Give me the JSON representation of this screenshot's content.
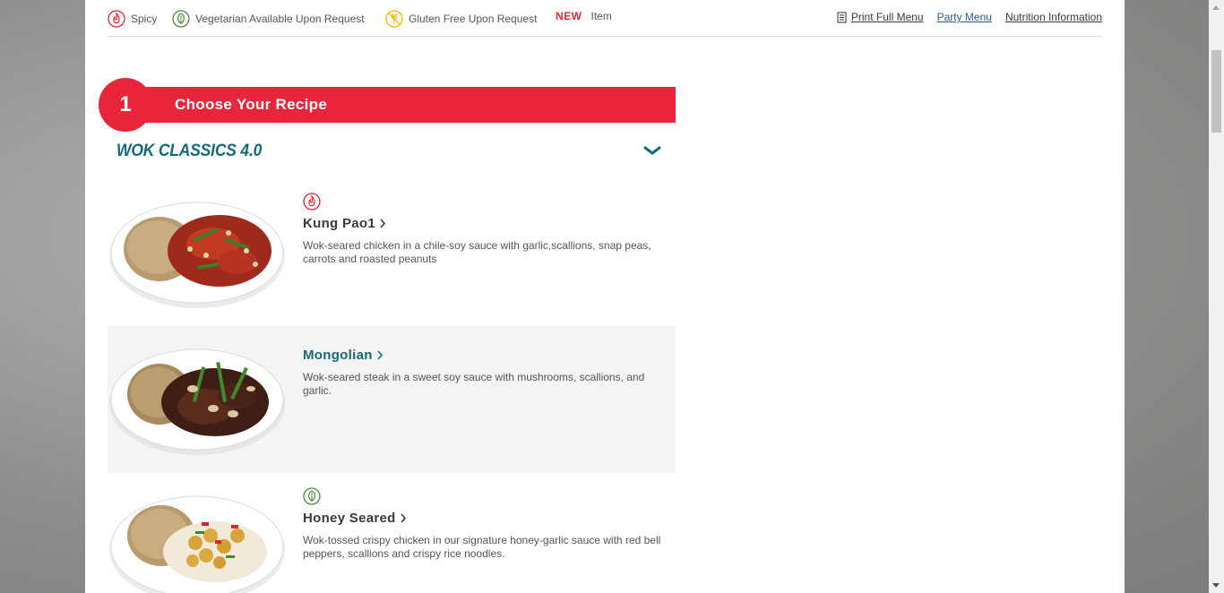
{
  "legend": {
    "spicy": "Spicy",
    "vegetarian": "Vegetarian Available Upon Request",
    "gluten_free": "Gluten Free Upon Request",
    "new_badge": "NEW",
    "new_item": "Item"
  },
  "toplinks": {
    "print": "Print Full Menu",
    "party": "Party Menu",
    "nutrition": "Nutrition Information"
  },
  "step": {
    "number": "1",
    "title": "Choose Your Recipe"
  },
  "category": {
    "title": "WOK CLASSICS 4.0",
    "chevron_icon": "chevron-down-icon"
  },
  "menu_items": [
    {
      "name": "Kung Pao",
      "superscript": "1",
      "description": "Wok-seared chicken in a chile-soy sauce with garlic,scallions, snap peas, carrots and roasted peanuts",
      "badge": "spicy-icon"
    },
    {
      "name": "Mongolian",
      "description": "Wok-seared steak in a sweet soy sauce with mushrooms, scallions, and garlic."
    },
    {
      "name": "Honey Seared",
      "description": "Wok-tossed crispy chicken in our signature honey-garlic sauce with red bell peppers, scallions and crispy rice noodles.",
      "badge": "vegetarian-icon"
    }
  ],
  "colors": {
    "accent_red": "#e8253a",
    "teal": "#136b78",
    "gluten_yellow": "#f5b800",
    "veg_green": "#4f8a3c"
  }
}
